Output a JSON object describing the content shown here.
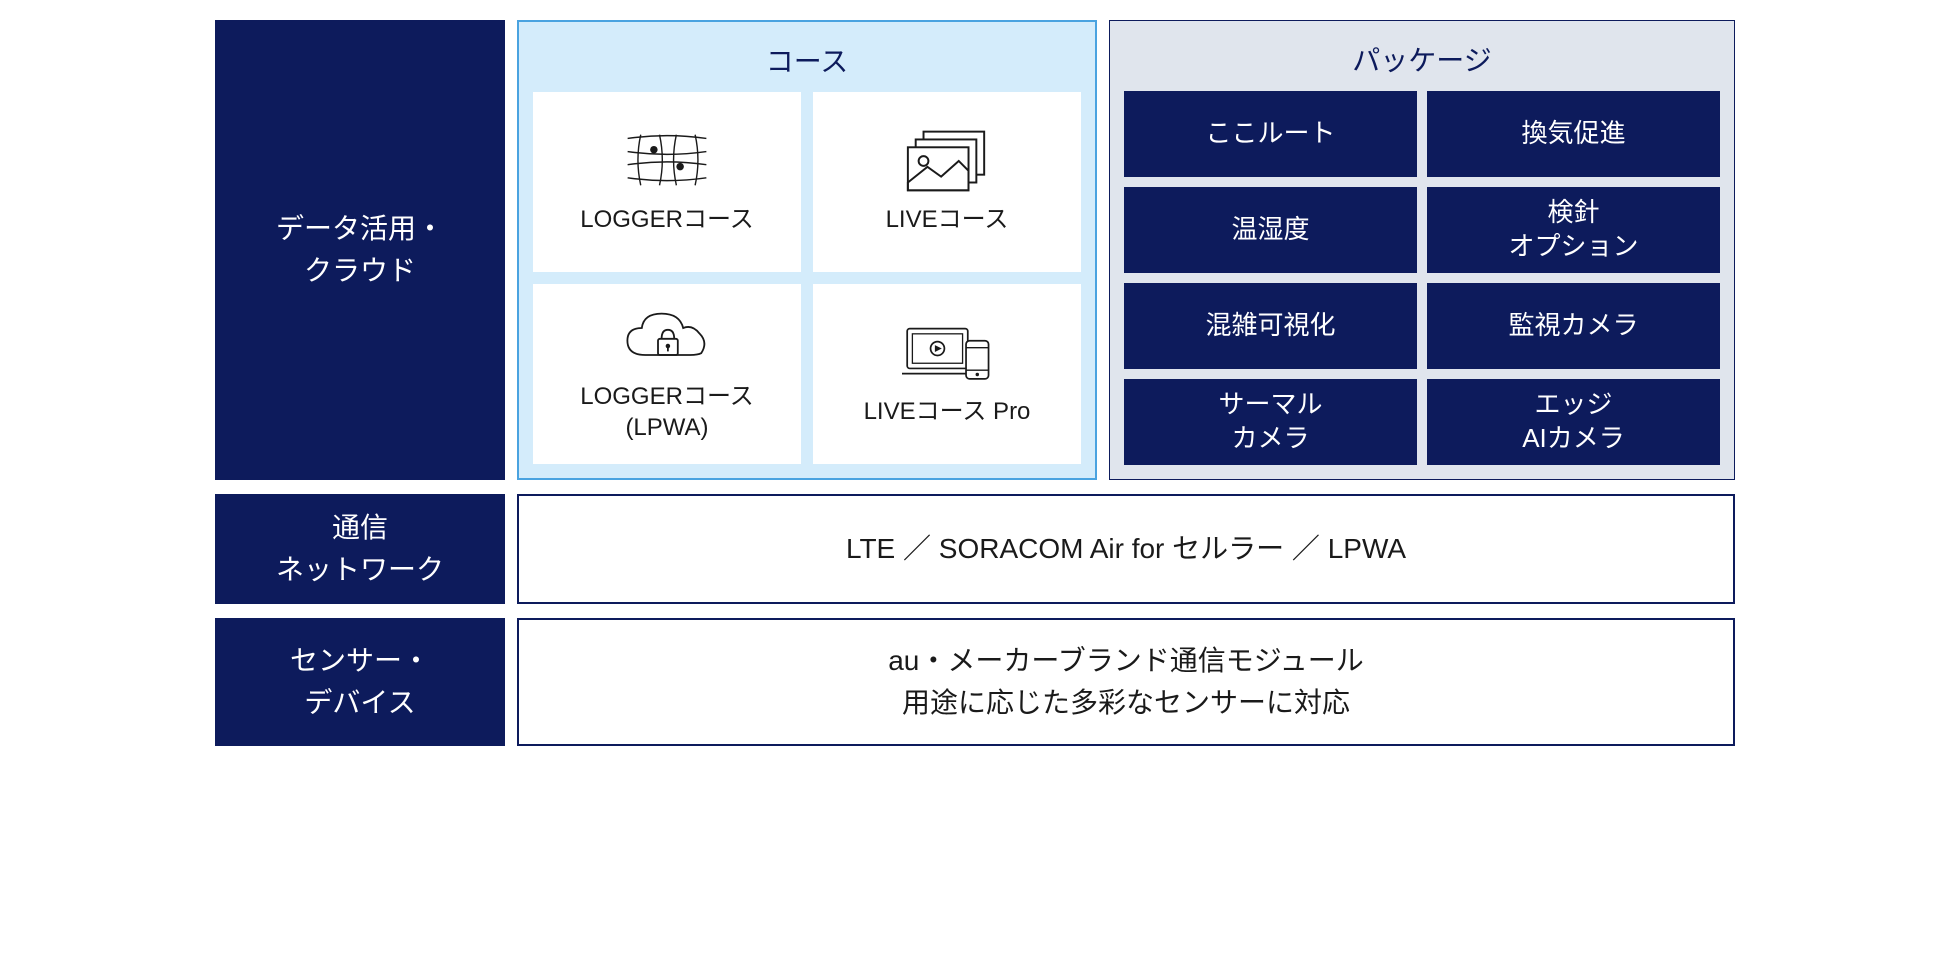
{
  "rows": {
    "data_cloud": {
      "label": "データ活用・\nクラウド",
      "course": {
        "header": "コース",
        "items": [
          {
            "label": "LOGGERコース",
            "icon": "grid"
          },
          {
            "label": "LIVEコース",
            "icon": "photos"
          },
          {
            "label": "LOGGERコース\n(LPWA)",
            "icon": "cloud-lock"
          },
          {
            "label": "LIVEコース Pro",
            "icon": "devices"
          }
        ]
      },
      "package": {
        "header": "パッケージ",
        "items": [
          "ここルート",
          "換気促進",
          "温湿度",
          "検針\nオプション",
          "混雑可視化",
          "監視カメラ",
          "サーマル\nカメラ",
          "エッジ\nAIカメラ"
        ]
      }
    },
    "network": {
      "label": "通信\nネットワーク",
      "content": "LTE ／ SORACOM Air for セルラー ／ LPWA"
    },
    "sensors": {
      "label": "センサー・\nデバイス",
      "content_line1": "au・メーカーブランド通信モジュール",
      "content_line2": "用途に応じた多彩なセンサーに対応"
    }
  }
}
